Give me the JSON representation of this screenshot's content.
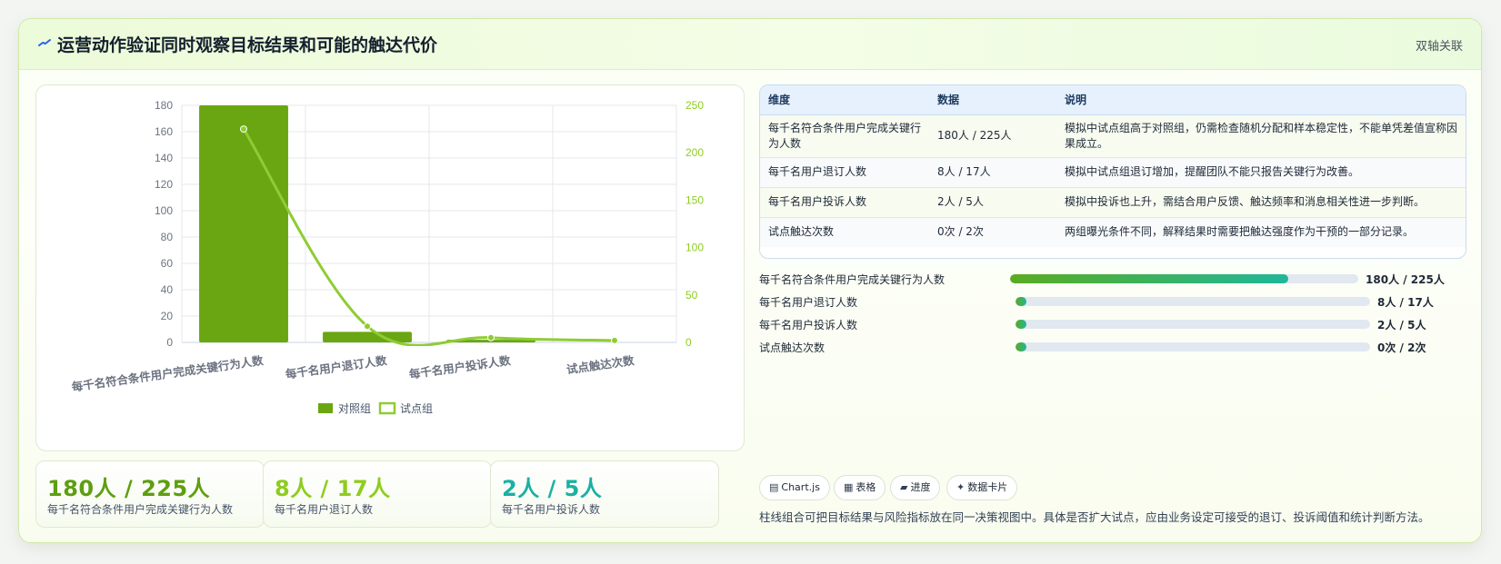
{
  "header": {
    "title": "运营动作验证同时观察目标结果和可能的触达代价",
    "tag": "双轴关联"
  },
  "colors": {
    "control": "#6aa611",
    "pilot_line": "#8fcc33",
    "kpi_green": "#5f9e11",
    "kpi_lime": "#8fcc1f",
    "kpi_teal": "#1bb0a4"
  },
  "chart_data": {
    "type": "bar",
    "categories": [
      "每千名符合条件用户完成关键行为人数",
      "每千名用户退订人数",
      "每千名用户投诉人数",
      "试点触达次数"
    ],
    "series": [
      {
        "name": "对照组",
        "type": "bar",
        "axis": "left",
        "values": [
          180,
          8,
          2,
          0
        ]
      },
      {
        "name": "试点组",
        "type": "line",
        "axis": "right",
        "values": [
          225,
          17,
          5,
          2
        ]
      }
    ],
    "y_left": {
      "min": 0,
      "max": 180,
      "ticks": [
        0,
        20,
        40,
        60,
        80,
        100,
        120,
        140,
        160,
        180
      ]
    },
    "y_right": {
      "min": 0,
      "max": 250,
      "ticks": [
        0,
        50,
        100,
        150,
        200,
        250
      ]
    },
    "legend": [
      "对照组",
      "试点组"
    ],
    "legend_position": "bottom",
    "grid": true
  },
  "kpis": [
    {
      "value": "180人 / 225人",
      "label": "每千名符合条件用户完成关键行为人数",
      "color": "#5f9e11"
    },
    {
      "value": "8人 / 17人",
      "label": "每千名用户退订人数",
      "color": "#8fcc1f"
    },
    {
      "value": "2人 / 5人",
      "label": "每千名用户投诉人数",
      "color": "#1bb0a4"
    }
  ],
  "table": {
    "headers": [
      "维度",
      "数据",
      "说明"
    ],
    "rows": [
      {
        "dimension": "每千名符合条件用户完成关键行为人数",
        "data": "180人 / 225人",
        "note": "模拟中试点组高于对照组，仍需检查随机分配和样本稳定性，不能单凭差值宣称因果成立。"
      },
      {
        "dimension": "每千名用户退订人数",
        "data": "8人 / 17人",
        "note": "模拟中试点组退订增加，提醒团队不能只报告关键行为改善。"
      },
      {
        "dimension": "每千名用户投诉人数",
        "data": "2人 / 5人",
        "note": "模拟中投诉也上升，需结合用户反馈、触达频率和消息相关性进一步判断。"
      },
      {
        "dimension": "试点触达次数",
        "data": "0次 / 2次",
        "note": "两组曝光条件不同，解释结果时需要把触达强度作为干预的一部分记录。"
      }
    ]
  },
  "progress": [
    {
      "label": "每千名符合条件用户完成关键行为人数",
      "value": "180人 / 225人",
      "fraction": 0.8
    },
    {
      "label": "每千名用户退订人数",
      "value": "8人 / 17人",
      "fraction": 0.03
    },
    {
      "label": "每千名用户投诉人数",
      "value": "2人 / 5人",
      "fraction": 0.03
    },
    {
      "label": "试点触达次数",
      "value": "0次 / 2次",
      "fraction": 0.03
    }
  ],
  "chips": [
    {
      "icon": "▤",
      "label": "Chart.js",
      "icon_name": "chart-icon"
    },
    {
      "icon": "▦",
      "label": "表格",
      "icon_name": "table-icon"
    },
    {
      "icon": "▰",
      "label": "进度",
      "icon_name": "progress-icon"
    },
    {
      "icon": "✦",
      "label": "数据卡片",
      "icon_name": "card-icon"
    }
  ],
  "footnote": "柱线组合可把目标结果与风险指标放在同一决策视图中。具体是否扩大试点，应由业务设定可接受的退订、投诉阈值和统计判断方法。"
}
